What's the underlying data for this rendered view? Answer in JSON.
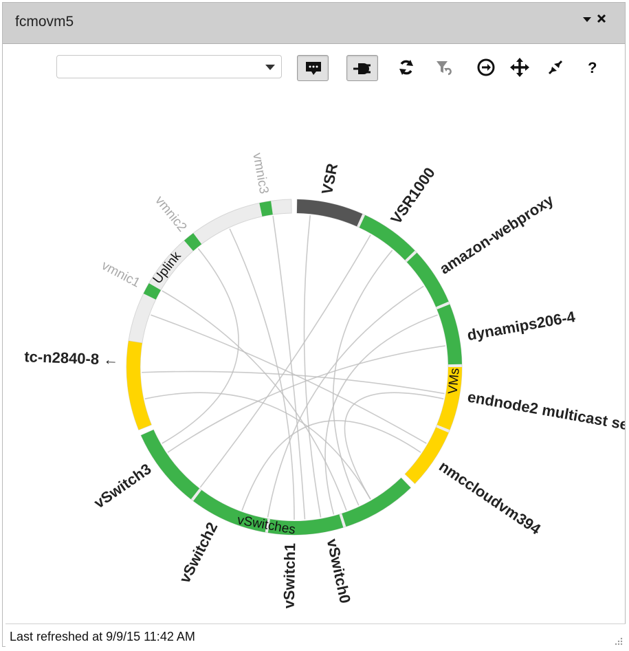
{
  "window": {
    "title": "fcmovm5"
  },
  "toolbar": {
    "select_value": ""
  },
  "chart_data": {
    "type": "chord",
    "groups": [
      {
        "name": "Uplink",
        "nodes": [
          "vmnic1",
          "vmnic2",
          "vmnic3"
        ]
      },
      {
        "name": "VMs",
        "nodes": [
          "VSR",
          "VSR1000",
          "amazon-webproxy",
          "dynamips206-4",
          "endnode2 multicast se",
          "nmccloudvm394"
        ]
      },
      {
        "name": "vSwitches",
        "nodes": [
          "vSwitch0",
          "vSwitch1",
          "vSwitch2",
          "vSwitch3"
        ]
      },
      {
        "name": "",
        "nodes": [
          "tc-n2840-8 ←"
        ]
      }
    ],
    "node_status_colors": {
      "VSR": "#555555",
      "VSR1000": "#3db34a",
      "amazon-webproxy": "#3db34a",
      "dynamips206-4": "#3db34a",
      "endnode2 multicast se": "#ffd500",
      "nmccloudvm394": "#ffd500",
      "vSwitch0": "#3db34a",
      "vSwitch1": "#3db34a",
      "vSwitch2": "#3db34a",
      "vSwitch3": "#3db34a",
      "tc-n2840-8 ←": "#ffd500",
      "vmnic1": "#3db34a",
      "vmnic2": "#3db34a",
      "vmnic3": "#3db34a"
    }
  },
  "status": {
    "last_refreshed": "Last refreshed at 9/9/15 11:42 AM"
  }
}
